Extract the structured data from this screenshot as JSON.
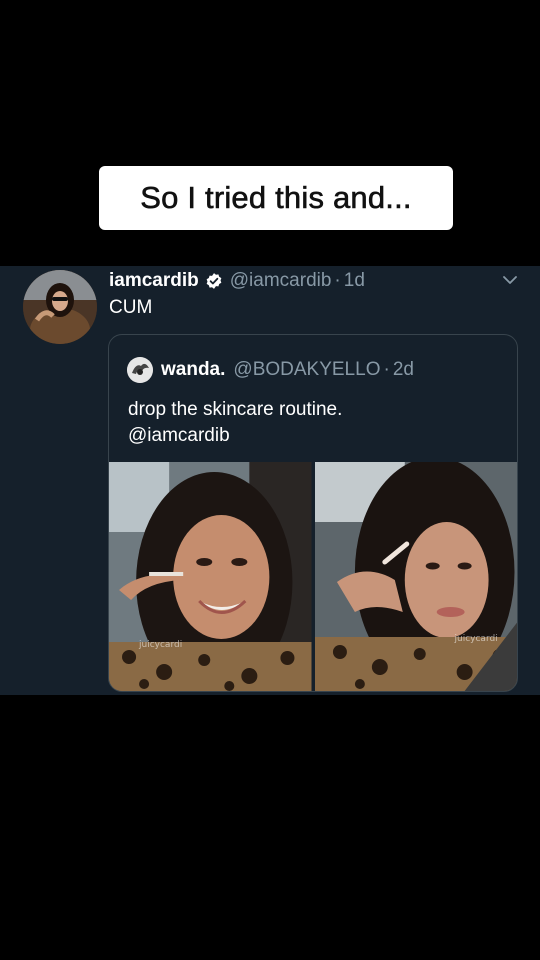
{
  "caption": {
    "text": "So I tried this and..."
  },
  "tweet": {
    "display_name": "iamcardib",
    "handle": "@iamcardib",
    "separator": "·",
    "time": "1d",
    "text": "CUM",
    "verified_icon": "verified-badge-icon",
    "menu_icon": "chevron-down-icon"
  },
  "quoted_tweet": {
    "display_name": "wanda.",
    "handle": "@BODAKYELLO",
    "separator": "·",
    "time": "2d",
    "text_line1": "drop the skincare routine.",
    "text_line2": "@iamcardib",
    "photos": [
      {
        "watermark": "juicycardi"
      },
      {
        "watermark": "juicycardi"
      }
    ]
  },
  "colors": {
    "background": "#000000",
    "tweet_bg": "#15202b",
    "secondary_text": "#8899a6",
    "border": "#38444d",
    "verified": "#ffffff"
  }
}
